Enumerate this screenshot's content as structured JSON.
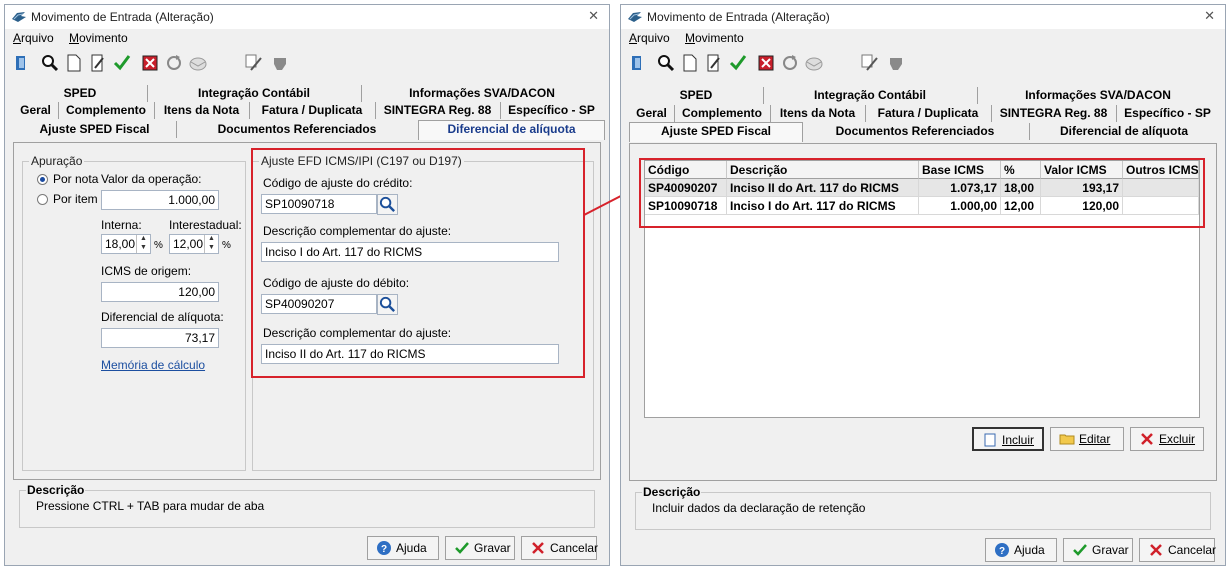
{
  "colors": {
    "accent": "#1a3c8c",
    "highlight": "#d7222b",
    "link": "#1c4fa0"
  },
  "window_left": {
    "title": "Movimento de Entrada (Alteração)",
    "menu": [
      {
        "underline": "A",
        "rest": "rquivo"
      },
      {
        "underline": "M",
        "rest": "ovimento"
      }
    ],
    "tabs_row1": [
      "SPED",
      "Integração Contábil",
      "Informações SVA/DACON"
    ],
    "tabs_row2": [
      "Geral",
      "Complemento",
      "Itens da Nota",
      "Fatura / Duplicata",
      "SINTEGRA Reg. 88",
      "Específico - SP"
    ],
    "tabs_row3": [
      "Ajuste SPED Fiscal",
      "Documentos Referenciados",
      "Diferencial de alíquota"
    ],
    "apuracao": {
      "legend": "Apuração",
      "por_nota": "Por nota",
      "por_item": "Por item",
      "valor_operacao_label": "Valor da operação:",
      "valor_operacao": "1.000,00",
      "interna_label": "Interna:",
      "interna": "18,00",
      "interestadual_label": "Interestadual:",
      "interestadual": "12,00",
      "percent": "%",
      "icms_origem_label": "ICMS de origem:",
      "icms_origem": "120,00",
      "diferencial_label": "Diferencial de alíquota:",
      "diferencial": "73,17",
      "memoria_link": "Memória de cálculo"
    },
    "ajuste": {
      "legend": "Ajuste EFD ICMS/IPI (C197 ou D197)",
      "cod_credito_label": "Código de ajuste do crédito:",
      "cod_credito": "SP10090718",
      "desc_comp_label": "Descrição complementar do ajuste:",
      "desc_credito": "Inciso I do Art. 117 do RICMS",
      "cod_debito_label": "Código de ajuste do débito:",
      "cod_debito": "SP40090207",
      "desc_debito": "Inciso II do Art. 117 do RICMS"
    },
    "descricao": {
      "legend": "Descrição",
      "text": "Pressione CTRL + TAB para  mudar de aba"
    },
    "footer": {
      "ajuda": "Ajuda",
      "gravar": "Gravar",
      "cancelar": "Cancelar"
    }
  },
  "window_right": {
    "title": "Movimento de Entrada (Alteração)",
    "menu": [
      {
        "underline": "A",
        "rest": "rquivo"
      },
      {
        "underline": "M",
        "rest": "ovimento"
      }
    ],
    "tabs_row1": [
      "SPED",
      "Integração Contábil",
      "Informações SVA/DACON"
    ],
    "tabs_row2": [
      "Geral",
      "Complemento",
      "Itens da Nota",
      "Fatura / Duplicata",
      "SINTEGRA Reg. 88",
      "Específico - SP"
    ],
    "tabs_row3": [
      "Ajuste SPED Fiscal",
      "Documentos Referenciados",
      "Diferencial de alíquota"
    ],
    "table": {
      "headers": [
        "Código",
        "Descrição",
        "Base ICMS",
        "%",
        "Valor ICMS",
        "Outros ICMS"
      ],
      "rows": [
        [
          "SP40090207",
          "Inciso II do Art. 117 do RICMS",
          "1.073,17",
          "18,00",
          "193,17",
          ""
        ],
        [
          "SP10090718",
          "Inciso I do Art. 117 do RICMS",
          "1.000,00",
          "12,00",
          "120,00",
          ""
        ]
      ]
    },
    "buttons": {
      "incluir": "Incluir",
      "editar": "Editar",
      "excluir": "Excluir"
    },
    "descricao": {
      "legend": "Descrição",
      "text": "Incluir dados da declaração de retenção"
    },
    "footer": {
      "ajuda": "Ajuda",
      "gravar": "Gravar",
      "cancelar": "Cancelar"
    }
  }
}
